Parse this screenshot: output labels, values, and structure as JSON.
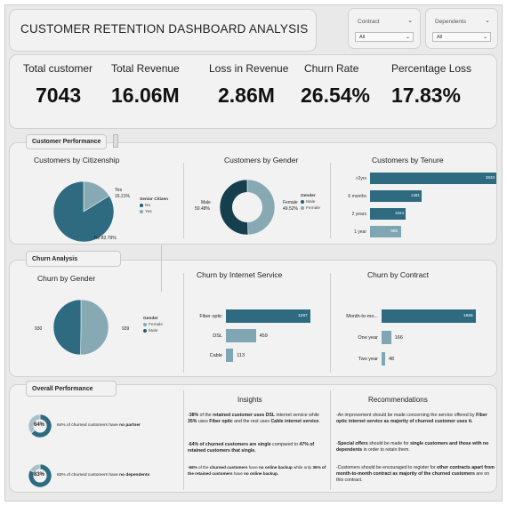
{
  "title": "CUSTOMER RETENTION DASHBOARD ANALYSIS",
  "slicers": [
    {
      "label": "Contract",
      "value": "All"
    },
    {
      "label": "Dependents",
      "value": "All"
    }
  ],
  "kpis": [
    {
      "label": "Total customer",
      "value": "7043"
    },
    {
      "label": "Total Revenue",
      "value": "16.06M"
    },
    {
      "label": "Loss in Revenue",
      "value": "2.86M"
    },
    {
      "label": "Churn Rate",
      "value": "26.54%"
    },
    {
      "label": "Percentage Loss",
      "value": "17.83%"
    }
  ],
  "sections": {
    "customer_performance": "Customer Performance",
    "churn_analysis": "Churn Analysis",
    "overall_performance": "Overall Performance"
  },
  "citizenship": {
    "title": "Customers by Citizenship",
    "legend_title": "Senior Citizen",
    "legend": [
      "No",
      "Yes"
    ],
    "yes_label": "Yes",
    "yes_pct": "16.21%",
    "no_label": "No 83.79%",
    "yes_share": 16.21
  },
  "gender": {
    "title": "Customers by Gender",
    "legend_title": "Gender",
    "legend": [
      "Male",
      "Female"
    ],
    "male_label": "Male",
    "male_pct": "50.48%",
    "female_label": "Female",
    "female_pct": "49.52%",
    "male_share": 50.48
  },
  "tenure": {
    "title": "Customers by Tenure",
    "bars": [
      {
        "label": ">2yrs",
        "value": 3633,
        "text": "3633"
      },
      {
        "label": "6 months",
        "value": 1481,
        "text": "1481"
      },
      {
        "label": "2 years",
        "value": 1024,
        "text": "1024"
      },
      {
        "label": "1 year",
        "value": 905,
        "text": "905"
      }
    ]
  },
  "churn_gender": {
    "title": "Churn by Gender",
    "legend_title": "Gender",
    "legend": [
      "Female",
      "Male"
    ],
    "left_value": "930",
    "right_value": "939",
    "female_share": 49.76
  },
  "churn_internet": {
    "title": "Churn by Internet Service",
    "bars": [
      {
        "label": "Fiber optic",
        "value": 1297,
        "text": "1297"
      },
      {
        "label": "DSL",
        "value": 459,
        "text": "459"
      },
      {
        "label": "Cable",
        "value": 113,
        "text": "113"
      }
    ]
  },
  "churn_contract": {
    "title": "Churn by Contract",
    "bars": [
      {
        "label": "Month-to-mo...",
        "value": 1655,
        "text": "1655"
      },
      {
        "label": "One year",
        "value": 166,
        "text": "166"
      },
      {
        "label": "Two year",
        "value": 48,
        "text": "48"
      }
    ]
  },
  "overall": {
    "donut1": {
      "pct_text": "64%",
      "value": 64,
      "caption": "64% of churned customers have ",
      "bold": "no partner"
    },
    "donut2": {
      "pct_text": "83%",
      "value": 83,
      "caption": "83% of churned customers have ",
      "bold": "no dependents"
    },
    "insights_title": "Insights",
    "recommendations_title": "Recommendations"
  },
  "colors": {
    "dark": "#1f5f73",
    "mid": "#2e6b80",
    "light": "#86a9b4"
  }
}
